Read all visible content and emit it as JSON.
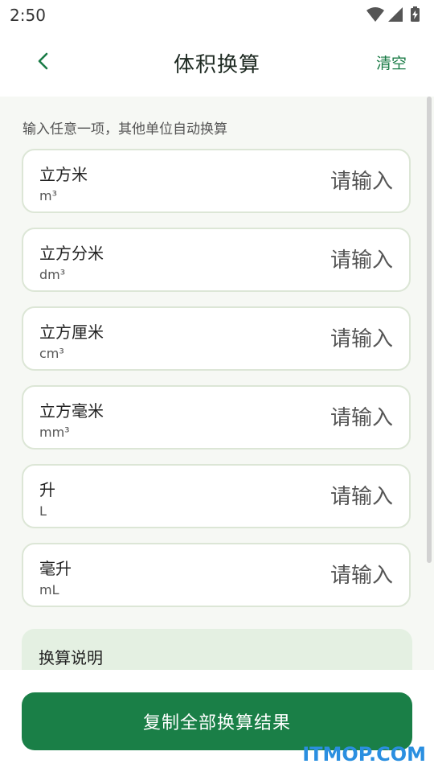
{
  "status_bar": {
    "time": "2:50",
    "icons": [
      "wifi-icon",
      "signal-icon",
      "battery-charging-icon"
    ]
  },
  "header": {
    "title": "体积换算",
    "clear_label": "清空",
    "back_icon": "chevron-left-icon"
  },
  "hint": "输入任意一项，其他单位自动换算",
  "units": [
    {
      "name": "立方米",
      "symbol": "m³",
      "placeholder": "请输入",
      "value": ""
    },
    {
      "name": "立方分米",
      "symbol": "dm³",
      "placeholder": "请输入",
      "value": ""
    },
    {
      "name": "立方厘米",
      "symbol": "cm³",
      "placeholder": "请输入",
      "value": ""
    },
    {
      "name": "立方毫米",
      "symbol": "mm³",
      "placeholder": "请输入",
      "value": ""
    },
    {
      "name": "升",
      "symbol": "L",
      "placeholder": "请输入",
      "value": ""
    },
    {
      "name": "毫升",
      "symbol": "mL",
      "placeholder": "请输入",
      "value": ""
    }
  ],
  "note": {
    "title": "换算说明"
  },
  "bottom": {
    "copy_label": "复制全部换算结果"
  },
  "watermark": "ITMOP.COM",
  "colors": {
    "accent": "#1a7f47",
    "background": "#f6f8f4",
    "card_border": "#dce6d6",
    "note_bg": "#e4f0e2"
  }
}
